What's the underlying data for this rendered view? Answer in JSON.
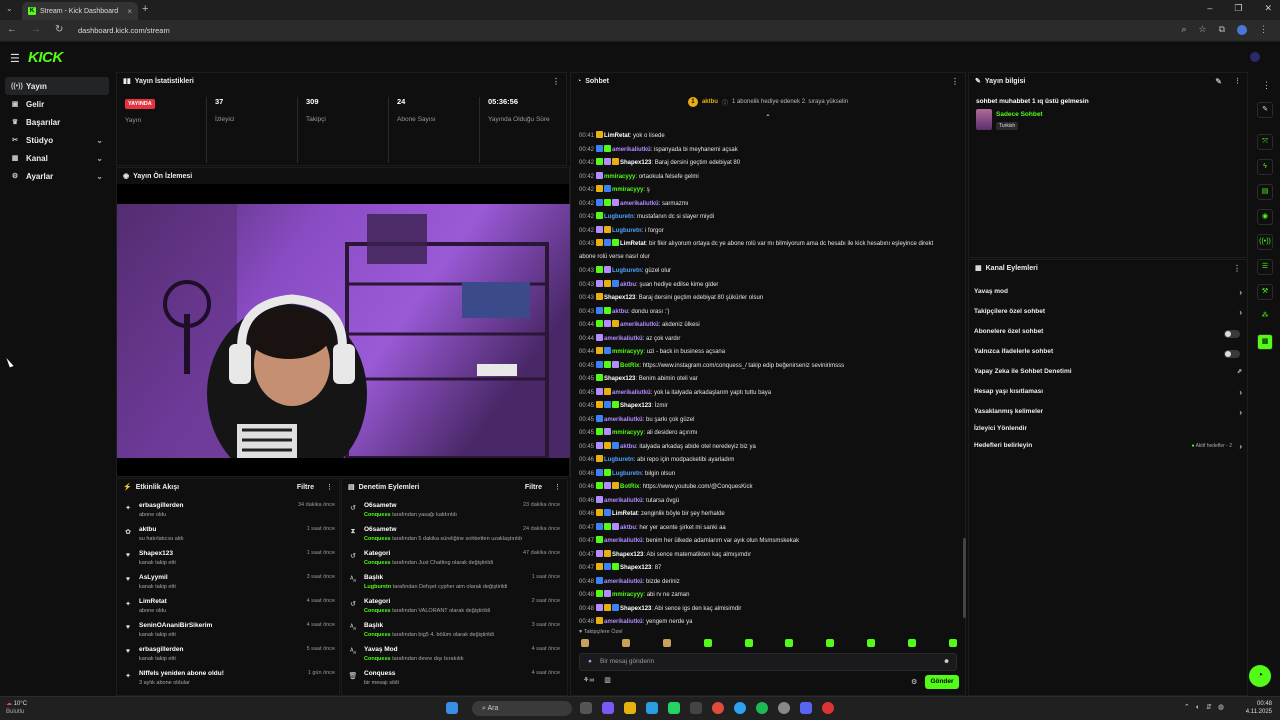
{
  "browser": {
    "tab_title": "Stream - Kick Dashboard",
    "url": "dashboard.kick.com/stream"
  },
  "app": {
    "logo": "KICK"
  },
  "sidebar": {
    "items": [
      {
        "label": "Yayın",
        "icon": "broadcast-icon"
      },
      {
        "label": "Gelir",
        "icon": "revenue-icon"
      },
      {
        "label": "Başarılar",
        "icon": "trophy-icon"
      },
      {
        "label": "Stüdyo",
        "icon": "studio-icon"
      },
      {
        "label": "Kanal",
        "icon": "channel-icon"
      },
      {
        "label": "Ayarlar",
        "icon": "gear-icon"
      }
    ]
  },
  "stats": {
    "title": "Yayın İstatistikleri",
    "live_badge": "YAYINDA",
    "live_label": "Yayın",
    "items": [
      {
        "value": "37",
        "label": "İzleyici"
      },
      {
        "value": "309",
        "label": "Takipçi"
      },
      {
        "value": "24",
        "label": "Abone Sayısı"
      },
      {
        "value": "05:36:56",
        "label": "Yayında Olduğu Süre"
      }
    ]
  },
  "preview": {
    "title": "Yayın Ön İzlemesi"
  },
  "activity": {
    "title": "Etkinlik Akışı",
    "filter": "Filtre",
    "items": [
      {
        "icon": "star-icon",
        "name": "erbasgillerden",
        "desc": "abone oldu",
        "time": "34 dakika önce"
      },
      {
        "icon": "gift-icon",
        "name": "aktbu",
        "desc": "su hatırlatıcısı aldı",
        "time": "1 saat önce"
      },
      {
        "icon": "heart-icon",
        "name": "Shapex123",
        "desc": "kanalı takip etti",
        "time": "1 saat önce"
      },
      {
        "icon": "heart-icon",
        "name": "AsLyymil",
        "desc": "kanalı takip etti",
        "time": "3 saat önce"
      },
      {
        "icon": "star-icon",
        "name": "LimRetat",
        "desc": "abone oldu",
        "time": "4 saat önce"
      },
      {
        "icon": "heart-icon",
        "name": "SeninOAnaniBirSikerim",
        "desc": "kanalı takip etti",
        "time": "4 saat önce"
      },
      {
        "icon": "heart-icon",
        "name": "erbasgillerden",
        "desc": "kanalı takip etti",
        "time": "5 saat önce"
      },
      {
        "icon": "star-icon",
        "name": "Nlffels yeniden abone oldu!",
        "desc": "3 aylık abone oldular",
        "time": "1 gün önce"
      }
    ]
  },
  "mod": {
    "title": "Denetim Eylemleri",
    "filter": "Filtre",
    "items": [
      {
        "icon": "undo-icon",
        "name": "O6sametw",
        "actor": "Conquess",
        "desc": "tarafından yasağı kaldırıldı",
        "time": "23 dakika önce"
      },
      {
        "icon": "hourglass-icon",
        "name": "O6sametw",
        "actor": "Conquess",
        "desc": "tarafından 5 dakika süreliğine sohbetten uzaklaştırıldı",
        "time": "24 dakika önce"
      },
      {
        "icon": "undo-icon",
        "name": "Kategori",
        "actor": "Conquess",
        "desc": "tarafından Just Chatting olarak değiştirildi",
        "time": "47 dakika önce"
      },
      {
        "icon": "title-icon",
        "name": "Başlık",
        "actor": "Lugburetn",
        "desc": "tarafından Dehşet cypher aim olarak değiştirildi",
        "time": "1 saat önce"
      },
      {
        "icon": "undo-icon",
        "name": "Kategori",
        "actor": "Conquess",
        "desc": "tarafından VALORANT olarak değiştirildi",
        "time": "2 saat önce"
      },
      {
        "icon": "title-icon",
        "name": "Başlık",
        "actor": "Conquess",
        "desc": "tarafından big5 4. bölüm olarak değiştirildi",
        "time": "3 saat önce"
      },
      {
        "icon": "title-icon",
        "name": "Yavaş Mod",
        "actor": "Conquess",
        "desc": "tarafından devre dışı bırakıldı",
        "time": "4 saat önce"
      },
      {
        "icon": "trash-icon",
        "name": "Conquess",
        "actor": "",
        "desc": "bir mesajı sildi",
        "time": "4 saat önce"
      }
    ]
  },
  "chat": {
    "title": "Sohbet",
    "pinned_user": "aktbu",
    "pinned_count": "1",
    "pinned_text": "1 abonelik hediye edenek 2. sıraya yükselin",
    "followers_only_label": "Takipçilere Özel",
    "input_placeholder": "Bir mesaj gönderin",
    "send_label": "Gönder",
    "messages": [
      {
        "ts": "00:41",
        "user": "LimRetat",
        "color": "#ffffff",
        "text": "yok o lisede"
      },
      {
        "ts": "00:42",
        "user": "amerikaliutkü",
        "color": "#b38cff",
        "text": "ispanyada bi meyhanemi açsak"
      },
      {
        "ts": "00:42",
        "user": "Shapex123",
        "color": "#ffffff",
        "text": "Baraj dersini geçtim edebiyat 80"
      },
      {
        "ts": "00:42",
        "user": "mmiracyyy",
        "color": "#53fc18",
        "text": "ortaokula felsefe gelmi"
      },
      {
        "ts": "00:42",
        "user": "mmiracyyy",
        "color": "#53fc18",
        "text": "ş"
      },
      {
        "ts": "00:42",
        "user": "amerikaliutkü",
        "color": "#b38cff",
        "text": "sarmazmı"
      },
      {
        "ts": "00:42",
        "user": "Lugburetn",
        "color": "#4da3ff",
        "text": "mustafanın dc si slayer miydi"
      },
      {
        "ts": "00:42",
        "user": "Lugburetn",
        "color": "#4da3ff",
        "text": "i forgor"
      },
      {
        "ts": "00:43",
        "user": "LimRetat",
        "color": "#ffffff",
        "text": "bir fikir alıyorum ortaya dc ye abone rolü var mı bilmiyorum ama dc hesabı ile kick hesabını eşleyince direkt"
      },
      {
        "ts": "",
        "user": "",
        "color": "#ffffff",
        "text": "abone rolü verse nasıl olur"
      },
      {
        "ts": "00:43",
        "user": "Lugburetn",
        "color": "#4da3ff",
        "text": "güzel olur"
      },
      {
        "ts": "00:43",
        "user": "aktbu",
        "color": "#b38cff",
        "text": "şuan hediye edilse kime gider"
      },
      {
        "ts": "00:43",
        "user": "Shapex123",
        "color": "#ffffff",
        "text": "Baraj dersini geçtim edebiyat 80 şükürler olsun"
      },
      {
        "ts": "00:43",
        "user": "aktbu",
        "color": "#b38cff",
        "text": "dondu orası :')"
      },
      {
        "ts": "00:44",
        "user": "amerikaliutkü",
        "color": "#b38cff",
        "text": "akdeniz ülkesi"
      },
      {
        "ts": "00:44",
        "user": "amerikaliutkü",
        "color": "#b38cff",
        "text": "az çok vardır"
      },
      {
        "ts": "00:44",
        "user": "mmiracyyy",
        "color": "#53fc18",
        "text": "uzi - back in business açsana"
      },
      {
        "ts": "00:45",
        "user": "BotRix",
        "color": "#53fc18",
        "text": "https://www.instagram.com/conquess_/ takip edip beğenirseniz sevinirimsss"
      },
      {
        "ts": "00:45",
        "user": "Shapex123",
        "color": "#ffffff",
        "text": "Benim abimin oteli var"
      },
      {
        "ts": "00:45",
        "user": "amerikaliutkü",
        "color": "#b38cff",
        "text": "yok la italyada arkadaşlarım yaptı tuttu baya"
      },
      {
        "ts": "00:45",
        "user": "Shapex123",
        "color": "#ffffff",
        "text": "İzmir"
      },
      {
        "ts": "00:45",
        "user": "amerikaliutkü",
        "color": "#b38cff",
        "text": "bu şarkı çok güzel"
      },
      {
        "ts": "00:45",
        "user": "mmiracyyy",
        "color": "#53fc18",
        "text": "ali desidero açırımı"
      },
      {
        "ts": "00:45",
        "user": "aktbu",
        "color": "#b38cff",
        "text": "italyada arkadaş abide otel neredeyiz biz ya"
      },
      {
        "ts": "00:46",
        "user": "Lugburetn",
        "color": "#4da3ff",
        "text": "abi repo için modpacketibi ayarladım"
      },
      {
        "ts": "00:46",
        "user": "Lugburetn",
        "color": "#4da3ff",
        "text": "bilgin olsun"
      },
      {
        "ts": "00:46",
        "user": "BotRix",
        "color": "#53fc18",
        "text": "https://www.youtube.com/@ConquesKick"
      },
      {
        "ts": "00:46",
        "user": "amerikaliutkü",
        "color": "#b38cff",
        "text": "tutarsa övgü"
      },
      {
        "ts": "00:46",
        "user": "LimRetat",
        "color": "#ffffff",
        "text": "zenginlik böyle bir şey herhalde"
      },
      {
        "ts": "00:47",
        "user": "aktbu",
        "color": "#b38cff",
        "text": "her yer acente şirket mi sanki aa"
      },
      {
        "ts": "00:47",
        "user": "amerikaliutkü",
        "color": "#b38cff",
        "text": "benim her ülkede adamlarım var ayık olun Msmsmskekak"
      },
      {
        "ts": "00:47",
        "user": "Shapex123",
        "color": "#ffffff",
        "text": "Abi sence matematikten kaç almışımdır"
      },
      {
        "ts": "00:47",
        "user": "Shapex123",
        "color": "#ffffff",
        "text": "87"
      },
      {
        "ts": "00:48",
        "user": "amerikaliutkü",
        "color": "#b38cff",
        "text": "bizde deriniz"
      },
      {
        "ts": "00:48",
        "user": "mmiracyyy",
        "color": "#53fc18",
        "text": "abi rv ne zaman"
      },
      {
        "ts": "00:48",
        "user": "Shapex123",
        "color": "#ffffff",
        "text": "Abi sence igs den kaç almisimdir"
      },
      {
        "ts": "00:48",
        "user": "amerikaliutkü",
        "color": "#b38cff",
        "text": "yengem nerde ya"
      }
    ]
  },
  "stream_info": {
    "title": "Yayın bilgisi",
    "stream_title": "sohbet muhabbet 1 ıq üstü gelmesin",
    "category": "Sadece Sohbet",
    "language": "Turkish"
  },
  "channel_actions": {
    "title": "Kanal Eylemleri",
    "items": [
      {
        "label": "Yavaş mod",
        "kind": "chevron"
      },
      {
        "label": "Takipçilere özel sohbet",
        "kind": "chevron"
      },
      {
        "label": "Abonelere özel sohbet",
        "kind": "toggle"
      },
      {
        "label": "Yalnızca ifadelerle sohbet",
        "kind": "toggle"
      },
      {
        "label": "Yapay Zeka ile Sohbet Denetimi",
        "kind": "external"
      },
      {
        "label": "Hesap yaşı kısıtlaması",
        "kind": "chevron"
      },
      {
        "label": "Yasaklanmış kelimeler",
        "kind": "chevron"
      },
      {
        "label": "İzleyici Yönlendir",
        "kind": "none"
      },
      {
        "label": "Hedefleri belirleyin",
        "kind": "goals"
      }
    ],
    "goals_status": "Aktif hedefler - 2"
  },
  "taskbar": {
    "temp": "10°C",
    "weather": "Bulutlu",
    "search": "Ara",
    "time": "00:48",
    "date": "4.11.2025"
  },
  "colors": {
    "accent": "#53fc18",
    "live": "#e3343f"
  }
}
